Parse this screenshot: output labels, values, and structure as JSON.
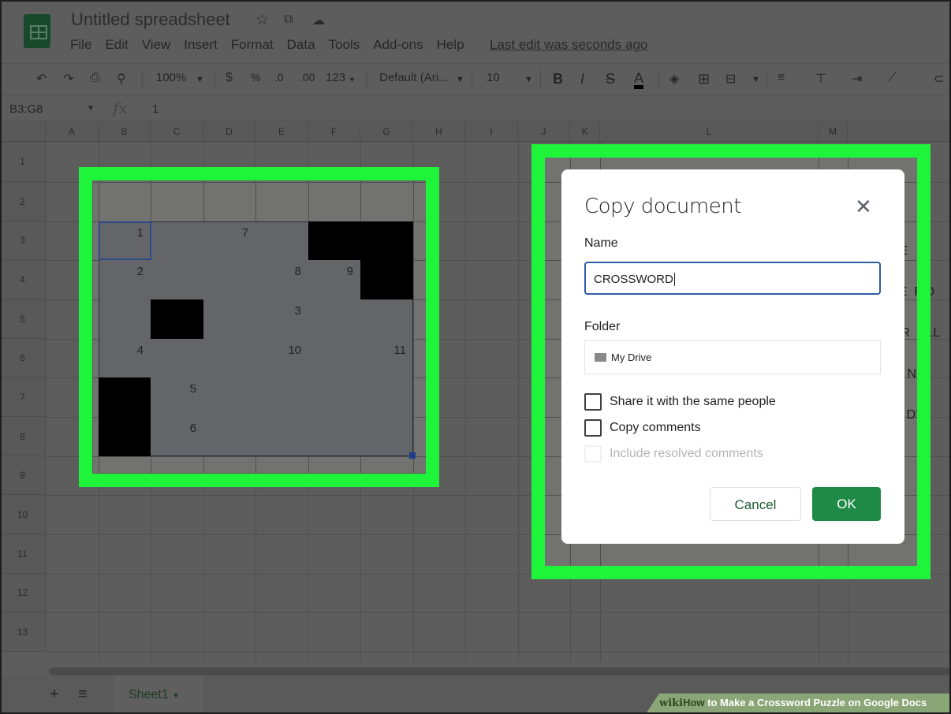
{
  "app": {
    "title": "Untitled spreadsheet",
    "title_icons": [
      "star-icon",
      "move-to-folder-icon",
      "cloud-saved-icon"
    ],
    "menu": [
      "File",
      "Edit",
      "View",
      "Insert",
      "Format",
      "Data",
      "Tools",
      "Add-ons",
      "Help"
    ],
    "last_edit": "Last edit was seconds ago"
  },
  "toolbar": {
    "zoom": "100%",
    "currency": "$",
    "percent": "%",
    "dec_decrease": ".0",
    "dec_increase": ".00",
    "number_format": "123",
    "font": "Default (Ari...",
    "font_size": "10",
    "bold": "B",
    "italic": "I",
    "strike": "S",
    "text_color": "A"
  },
  "formula_bar": {
    "name_box": "B3:G8",
    "fx": "fx",
    "value": "1"
  },
  "columns": [
    "A",
    "B",
    "C",
    "D",
    "E",
    "F",
    "G",
    "H",
    "I",
    "J",
    "K",
    "L",
    "M"
  ],
  "rows": [
    "1",
    "2",
    "3",
    "4",
    "5",
    "6",
    "7",
    "8",
    "9",
    "10",
    "11",
    "12",
    "13"
  ],
  "crossword": {
    "black_cells": [
      "F3",
      "G3",
      "G4",
      "C5",
      "B7",
      "B8"
    ],
    "numbers": [
      {
        "cell": "B3",
        "n": "1"
      },
      {
        "cell": "D3",
        "n": "7"
      },
      {
        "cell": "B4",
        "n": "2"
      },
      {
        "cell": "E4",
        "n": "8"
      },
      {
        "cell": "F4",
        "n": "9"
      },
      {
        "cell": "E5",
        "n": "3"
      },
      {
        "cell": "B6",
        "n": "4"
      },
      {
        "cell": "E6",
        "n": "10"
      },
      {
        "cell": "G6",
        "n": "11"
      },
      {
        "cell": "C7",
        "n": "5"
      },
      {
        "cell": "C8",
        "n": "6"
      }
    ]
  },
  "right_fragments": [
    "EE",
    "TE  F D",
    "OR  ULL",
    "D  NIM",
    "B  DY"
  ],
  "dialog": {
    "title": "Copy document",
    "name_label": "Name",
    "name_value": "CROSSWORD",
    "folder_label": "Folder",
    "folder_value": "My Drive",
    "checkboxes": [
      {
        "label": "Share it with the same people",
        "checked": false,
        "disabled": false
      },
      {
        "label": "Copy comments",
        "checked": false,
        "disabled": false
      },
      {
        "label": "Include resolved comments",
        "checked": false,
        "disabled": true
      }
    ],
    "cancel": "Cancel",
    "ok": "OK"
  },
  "sheets": {
    "add": "+",
    "list": "≡",
    "tab": "Sheet1"
  },
  "watermark": {
    "brand": "wiki",
    "how": "How",
    "text": " to Make a Crossword Puzzle on Google Docs"
  },
  "colors": {
    "highlight": "#1ef53a",
    "ok_button": "#1e8a46",
    "focus": "#2f5ba8"
  }
}
